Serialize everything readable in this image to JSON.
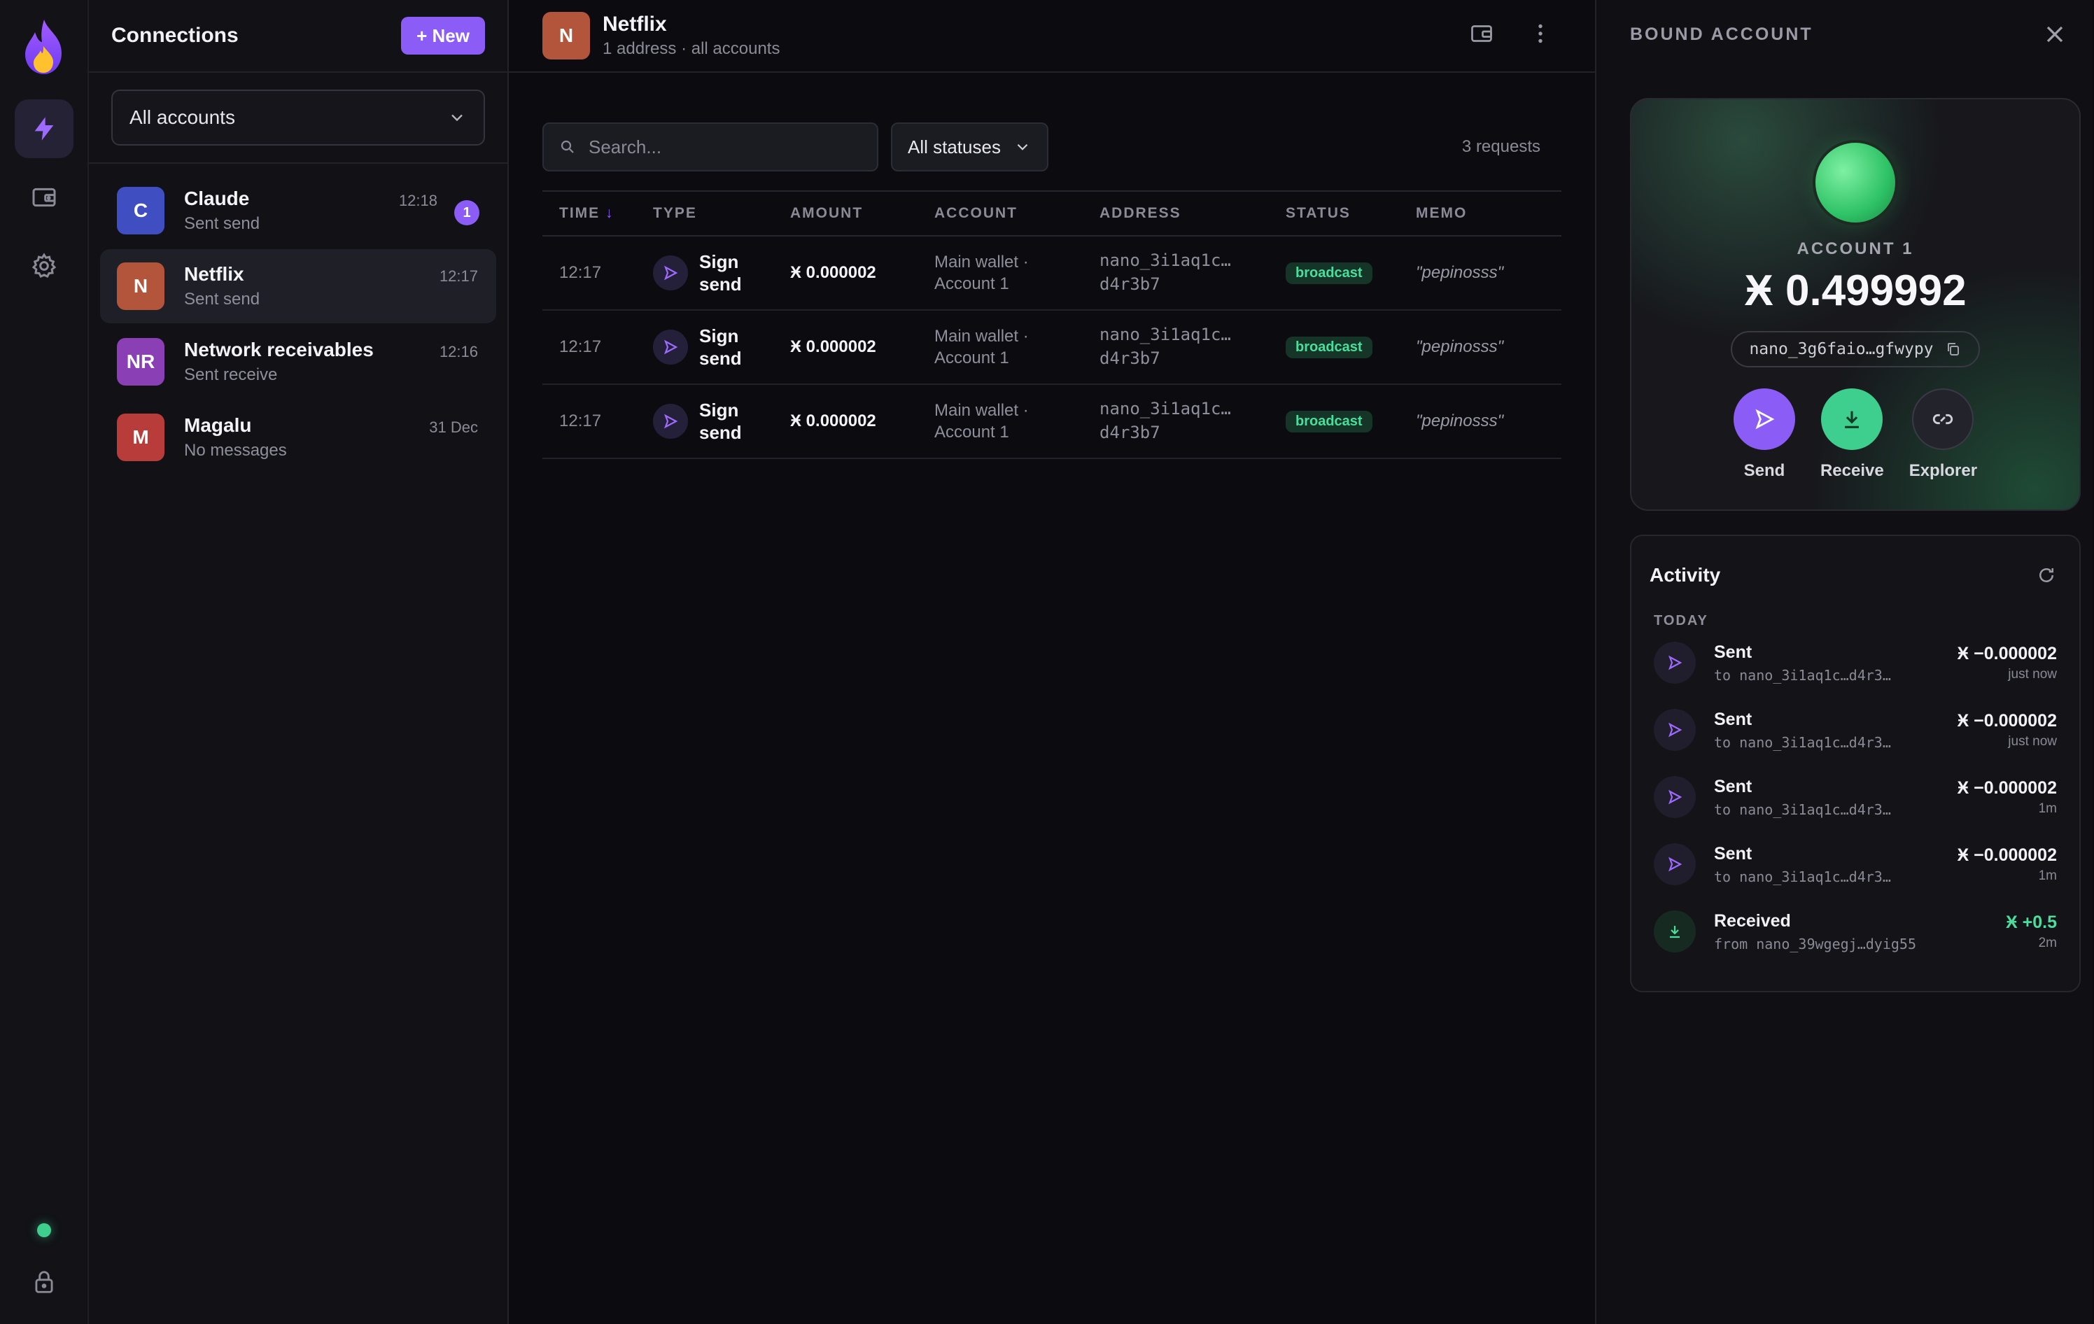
{
  "rail": {
    "icons": [
      "flame-logo",
      "bolt-icon",
      "wallet-icon",
      "gear-icon",
      "status-dot",
      "lock-icon"
    ]
  },
  "connections": {
    "title": "Connections",
    "new_label": "+ New",
    "account_filter": "All accounts",
    "items": [
      {
        "initials": "C",
        "name": "Claude",
        "sub": "Sent send",
        "time": "12:18",
        "badge": "1",
        "color": "#3f4fc2"
      },
      {
        "initials": "N",
        "name": "Netflix",
        "sub": "Sent send",
        "time": "12:17",
        "color": "#b3553a"
      },
      {
        "initials": "NR",
        "name": "Network receivables",
        "sub": "Sent receive",
        "time": "12:16",
        "color": "#8a3fb5"
      },
      {
        "initials": "M",
        "name": "Magalu",
        "sub": "No messages",
        "time": "31 Dec",
        "color": "#b73c3a"
      }
    ]
  },
  "main": {
    "avatar_initials": "N",
    "avatar_color": "#b3553a",
    "title": "Netflix",
    "subtitle": "1 address · all accounts",
    "search_placeholder": "Search...",
    "status_filter": "All statuses",
    "request_count": "3 requests",
    "columns": [
      "TIME",
      "TYPE",
      "AMOUNT",
      "ACCOUNT",
      "ADDRESS",
      "STATUS",
      "MEMO"
    ],
    "sort_arrow": "↓",
    "rows": [
      {
        "time": "12:17",
        "type_line1": "Sign",
        "type_line2": "send",
        "amount": "Ӿ 0.000002",
        "account_line1": "Main wallet ·",
        "account_line2": "Account 1",
        "address_line1": "nano_3i1aq1c…",
        "address_line2": "d4r3b7",
        "status": "broadcast",
        "memo": "\"pepinosss\""
      },
      {
        "time": "12:17",
        "type_line1": "Sign",
        "type_line2": "send",
        "amount": "Ӿ 0.000002",
        "account_line1": "Main wallet ·",
        "account_line2": "Account 1",
        "address_line1": "nano_3i1aq1c…",
        "address_line2": "d4r3b7",
        "status": "broadcast",
        "memo": "\"pepinosss\""
      },
      {
        "time": "12:17",
        "type_line1": "Sign",
        "type_line2": "send",
        "amount": "Ӿ 0.000002",
        "account_line1": "Main wallet ·",
        "account_line2": "Account 1",
        "address_line1": "nano_3i1aq1c…",
        "address_line2": "d4r3b7",
        "status": "broadcast",
        "memo": "\"pepinosss\""
      }
    ]
  },
  "bound": {
    "title": "BOUND ACCOUNT",
    "account_label": "ACCOUNT 1",
    "balance": "Ӿ 0.499992",
    "address": "nano_3g6faio…gfwypy",
    "actions": {
      "send": "Send",
      "receive": "Receive",
      "explorer": "Explorer"
    },
    "colors": {
      "send": "#8b5cf6",
      "receive": "#3ecf8e",
      "explorer": "#23232b"
    }
  },
  "activity": {
    "title": "Activity",
    "day": "TODAY",
    "items": [
      {
        "kind": "sent",
        "title": "Sent",
        "sub": "to nano_3i1aq1c…d4r3…",
        "amount": "Ӿ −0.000002",
        "when": "just now"
      },
      {
        "kind": "sent",
        "title": "Sent",
        "sub": "to nano_3i1aq1c…d4r3…",
        "amount": "Ӿ −0.000002",
        "when": "just now"
      },
      {
        "kind": "sent",
        "title": "Sent",
        "sub": "to nano_3i1aq1c…d4r3…",
        "amount": "Ӿ −0.000002",
        "when": "1m"
      },
      {
        "kind": "sent",
        "title": "Sent",
        "sub": "to nano_3i1aq1c…d4r3…",
        "amount": "Ӿ −0.000002",
        "when": "1m"
      },
      {
        "kind": "received",
        "title": "Received",
        "sub": "from nano_39wgegj…dyig55",
        "amount": "Ӿ +0.5",
        "when": "2m"
      }
    ]
  }
}
